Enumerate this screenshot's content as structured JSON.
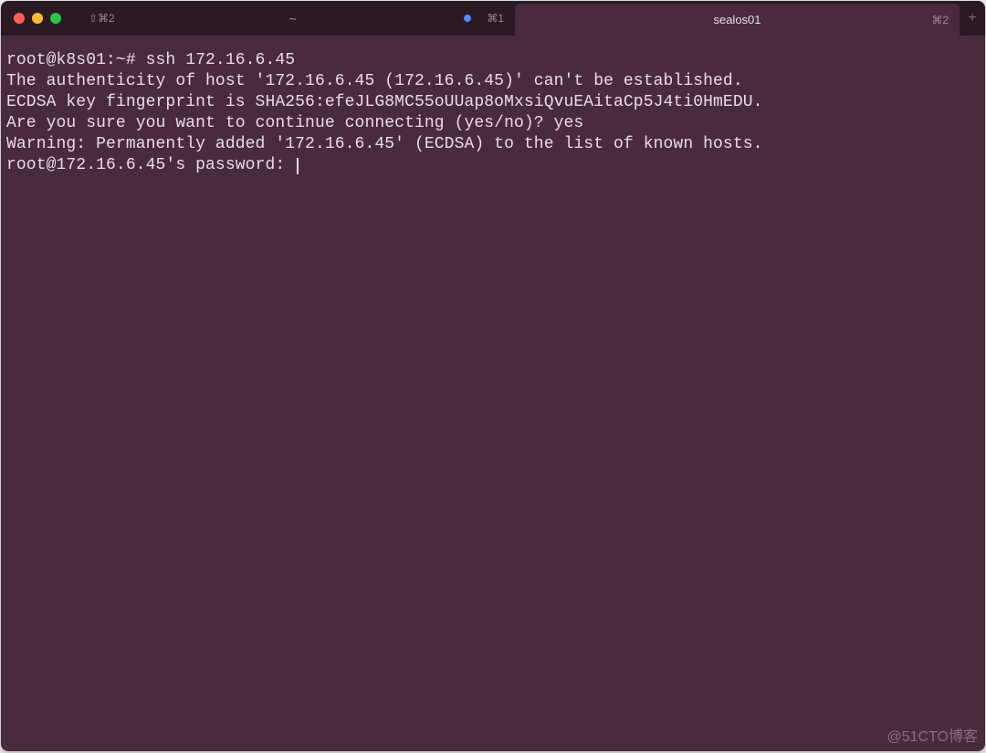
{
  "titlebar": {
    "tabs": [
      {
        "label": "~",
        "shortcut_left": "⇧⌘2",
        "shortcut_right": "⌘1",
        "has_blue_dot": true
      },
      {
        "label": "sealos01",
        "shortcut_right": "⌘2"
      }
    ],
    "new_tab_glyph": "+"
  },
  "terminal": {
    "prompt": "root@k8s01:~# ",
    "command": "ssh 172.16.6.45",
    "lines": [
      "The authenticity of host '172.16.6.45 (172.16.6.45)' can't be established.",
      "ECDSA key fingerprint is SHA256:efeJLG8MC55oUUap8oMxsiQvuEAitaCp5J4ti0HmEDU.",
      "Are you sure you want to continue connecting (yes/no)? yes",
      "Warning: Permanently added '172.16.6.45' (ECDSA) to the list of known hosts.",
      "root@172.16.6.45's password: "
    ]
  },
  "watermark": "@51CTO博客"
}
